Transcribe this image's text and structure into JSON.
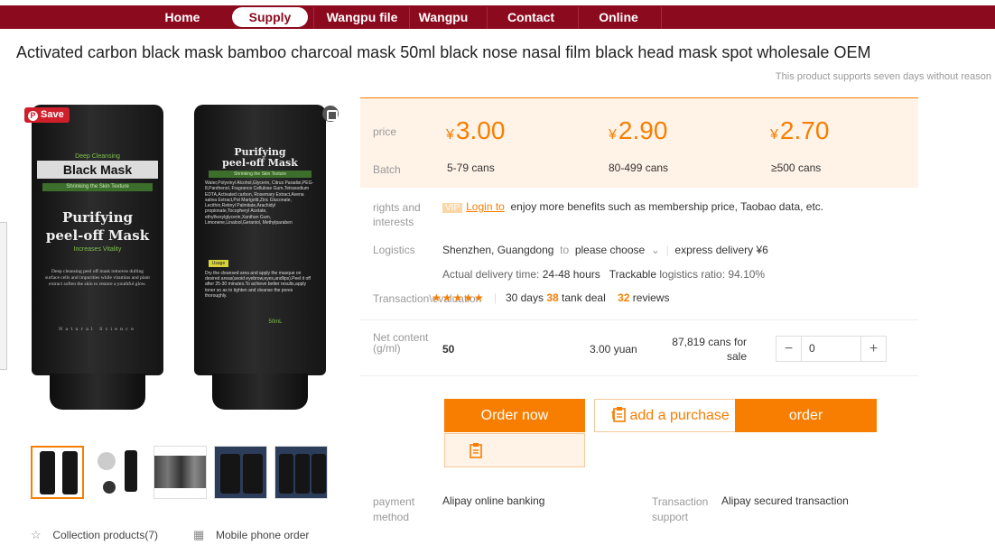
{
  "nav": {
    "items": [
      {
        "label": "Home"
      },
      {
        "label": "Supply"
      },
      {
        "label": "Wangpu file"
      },
      {
        "label": "Wangpu"
      },
      {
        "label": "Contact"
      },
      {
        "label": "Online"
      }
    ],
    "active_index": 1,
    "brand_color": "#8c0a1e"
  },
  "product": {
    "title": "Activated carbon black mask bamboo charcoal mask 50ml black nose nasal film black head mask spot wholesale OEM",
    "return_note": "This product supports seven days without reason"
  },
  "gallery": {
    "save_label": "Save",
    "save_glyph": "P",
    "tube_left": {
      "small_label": "Deep Cleansing",
      "line1": "Black Mask",
      "tagline": "Shrinking the Skin Texture",
      "line2": "Purifying",
      "line3": "peel-off Mask",
      "sub": "Increases Vitality",
      "body": "Deep cleansing peel off mask removes dulling surface cells and impurities while vitamins and plant extract soften the skin to restore a youthful glow.",
      "footer": "Natural Science"
    },
    "tube_right": {
      "line1": "Purifying",
      "line2": "peel-off Mask",
      "tagline": "Shrinking the Skin Texture",
      "ingredients": "Water,Polyvinyl Alcohol,Glycerin, Citrus Paradisi,PEG-8,Panthenol, Fragrance Cellulose Gum,Tetrasodium EDTA,Activated carbon, Rosemary Extract,Avena sativa Extract,Pot Marigold,Zinc Gluconate, Lecithin,Retinyl Palmitate,Arachidyl propionate,Tocopheryl Acetate, ethylhexylglycerin,Xanthan Gum, Limonene,Linalool,Geraniol, Methylparaben",
      "usage_label": "Usage",
      "usage": "Dry the cleansed area and apply the masque on desired areas(avoid eyebrow,eyes,andlips).Peel it off after 25-30 minutes.To achieve better results,apply toner so as to tighten and cleanse the pores thoroughly.",
      "volume": "50mL"
    },
    "thumb_count": 5,
    "selected_thumb": 0,
    "actions": {
      "collection": "Collection products(7)",
      "mobile": "Mobile phone order"
    }
  },
  "pricing": {
    "price_label": "price",
    "batch_label": "Batch",
    "currency": "¥",
    "tiers": [
      {
        "price": "3.00",
        "batch": "5-79 cans"
      },
      {
        "price": "2.90",
        "batch": "80-499 cans"
      },
      {
        "price": "2.70",
        "batch": "≥500 cans"
      }
    ],
    "accent": "#f77e00"
  },
  "rights": {
    "label_line1": "rights and",
    "label_line2": "interests",
    "vip": "VIP",
    "login": "Login to",
    "text": "enjoy more benefits such as membership price, Taobao data, etc."
  },
  "logistics": {
    "label": "Logistics",
    "origin": "Shenzhen, Guangdong",
    "to": "to",
    "destination": "please choose",
    "express": "express delivery ¥6",
    "delivery_label": "Actual delivery time:",
    "delivery_value": "24-48 hours",
    "trackable_label": "Trackable",
    "trackable_rest": "logistics ratio: 94.10%"
  },
  "transaction": {
    "label": "Transaction\\evaluation",
    "stars": "★★★★★",
    "days": "30 days",
    "deal_count": "38",
    "deal_text": "tank deal",
    "reviews_count": "32",
    "reviews_text": "reviews"
  },
  "spec": {
    "label_line1": "Net content",
    "label_line2": "(g/ml)",
    "value": "50",
    "unit_price": "3.00 yuan",
    "stock_line1": "87,819 cans for",
    "stock_line2": "sale",
    "quantity": "0",
    "minus": "−",
    "plus": "+"
  },
  "buttons": {
    "order_now": "Order now",
    "add_purchase": "add a purchase",
    "order": "order",
    "clip_glyph": "t"
  },
  "payment": {
    "label_line1": "payment",
    "label_line2": "method",
    "methods": "Alipay  online banking",
    "support_label_line1": "Transaction",
    "support_label_line2": "support",
    "support_value": "Alipay secured transaction"
  }
}
